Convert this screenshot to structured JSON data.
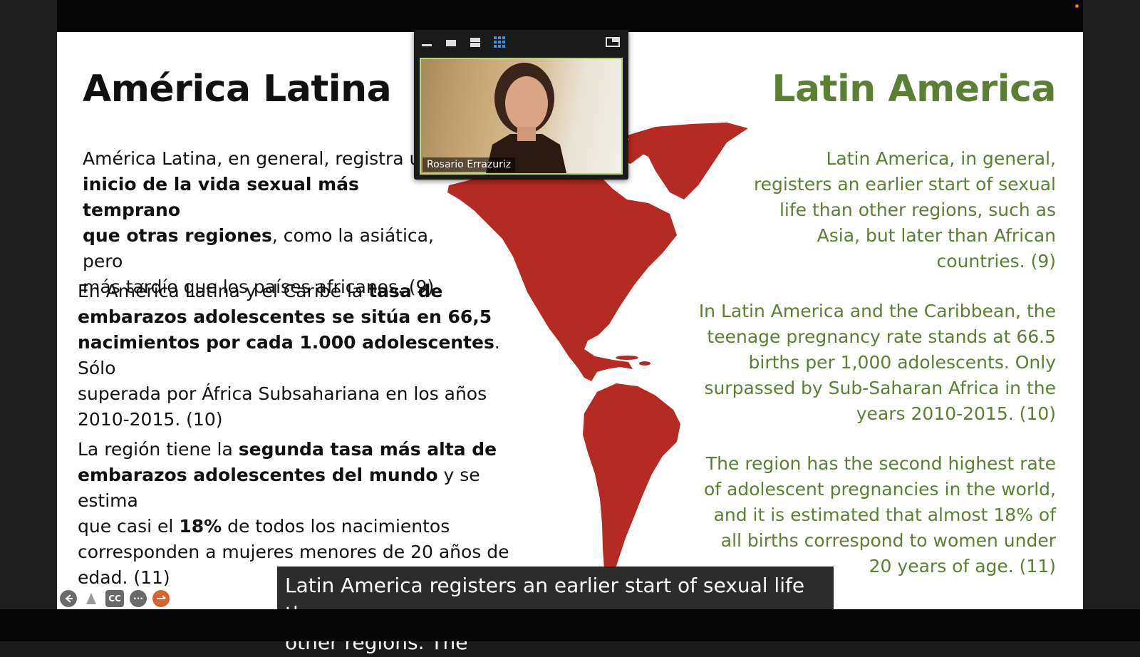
{
  "slide": {
    "title_es": "América Latina",
    "title_en": "Latin America",
    "es_p1": {
      "t1": "América Latina, en general, registra un",
      "b1": "inicio de la vida sexual más temprano",
      "b2": "que otras regiones",
      "t2": ", como la asiática, pero",
      "t3": "más tardío que los países africanos. (9)"
    },
    "es_p2": {
      "t1": "En América Latina y el Caribe la ",
      "b1": "tasa de",
      "b2": "embarazos adolescentes se sitúa en 66,5",
      "b3": "nacimientos por cada 1.000 adolescentes",
      "t2": ". Sólo",
      "t3": "superada por África Subsahariana en los años",
      "t4": "2010-2015. (10)"
    },
    "es_p3": {
      "t1": "La región tiene la ",
      "b1": "segunda tasa más alta de",
      "b2": "embarazos adolescentes del mundo",
      "t2": " y se estima",
      "t3": "que casi el ",
      "b3": "18%",
      "t4": " de todos los nacimientos",
      "t5": "corresponden a mujeres menores de 20 años de",
      "t6": "edad. (11)"
    },
    "en_p1": [
      "Latin America, in general,",
      "registers an earlier start of sexual",
      "life than other regions, such as",
      "Asia, but later than African",
      "countries. (9)"
    ],
    "en_p2": [
      "In Latin America and the Caribbean, the",
      "teenage pregnancy rate stands at 66.5",
      "births per 1,000 adolescents. Only",
      "surpassed by Sub-Saharan Africa in the",
      "years 2010-2015. (10)"
    ],
    "en_p3": [
      "The region has the second highest rate",
      "of adolescent pregnancies in the world,",
      "and it is estimated that almost 18% of",
      "all births correspond to women under",
      "20 years of age. (11)"
    ]
  },
  "video": {
    "participant_name": "Rosario Errazuriz",
    "toolbar_icons": [
      "minimize-icon",
      "single-view-icon",
      "side-by-side-icon",
      "gallery-grid-icon",
      "exit-panel-icon"
    ]
  },
  "controls": {
    "icons": [
      "back-arrow-icon",
      "pointer-icon",
      "closed-caption-icon",
      "more-icon",
      "pen-icon"
    ],
    "cc_label": "CC",
    "more_label": "···"
  },
  "caption": {
    "line1": "Latin America registers an earlier start of sexual life than",
    "line2": "other regions. The"
  },
  "colors": {
    "english_text": "#5b7f33",
    "map": "#b52a22",
    "video_border": "#b6d96a",
    "gallery_icon": "#3a8fe8"
  }
}
